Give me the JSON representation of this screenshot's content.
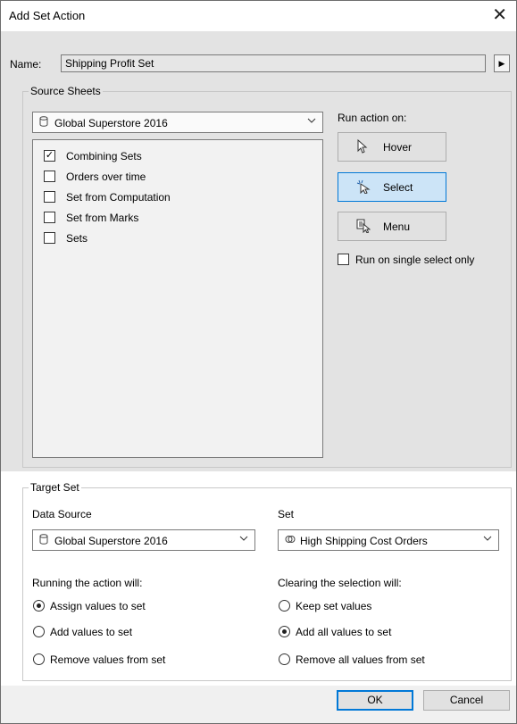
{
  "dialog": {
    "title": "Add Set Action",
    "close_glyph": "✕"
  },
  "name": {
    "label": "Name:",
    "value": "Shipping Profit Set",
    "arrow": "▶"
  },
  "source_sheets": {
    "label": "Source Sheets",
    "datasource": "Global Superstore 2016",
    "sheets": [
      {
        "label": "Combining Sets",
        "checked": true
      },
      {
        "label": "Orders over time",
        "checked": false
      },
      {
        "label": "Set from Computation",
        "checked": false
      },
      {
        "label": "Set from Marks",
        "checked": false
      },
      {
        "label": "Sets",
        "checked": false
      }
    ]
  },
  "run_action": {
    "label": "Run action on:",
    "hover": "Hover",
    "select": "Select",
    "menu": "Menu",
    "selected": "Select",
    "single_select": "Run on single select only"
  },
  "target_set": {
    "label": "Target Set",
    "datasource_label": "Data Source",
    "datasource": "Global Superstore 2016",
    "set_label": "Set",
    "set": "High Shipping Cost Orders"
  },
  "running_action": {
    "label": "Running the action will:",
    "options": [
      "Assign values to set",
      "Add values to set",
      "Remove values from set"
    ],
    "selected": 0
  },
  "clearing_selection": {
    "label": "Clearing the selection will:",
    "options": [
      "Keep set values",
      "Add all values to set",
      "Remove all values from set"
    ],
    "selected": 1
  },
  "footer": {
    "ok": "OK",
    "cancel": "Cancel"
  },
  "colors": {
    "accent": "#0078d7",
    "selected_fill": "#cce4f7"
  }
}
